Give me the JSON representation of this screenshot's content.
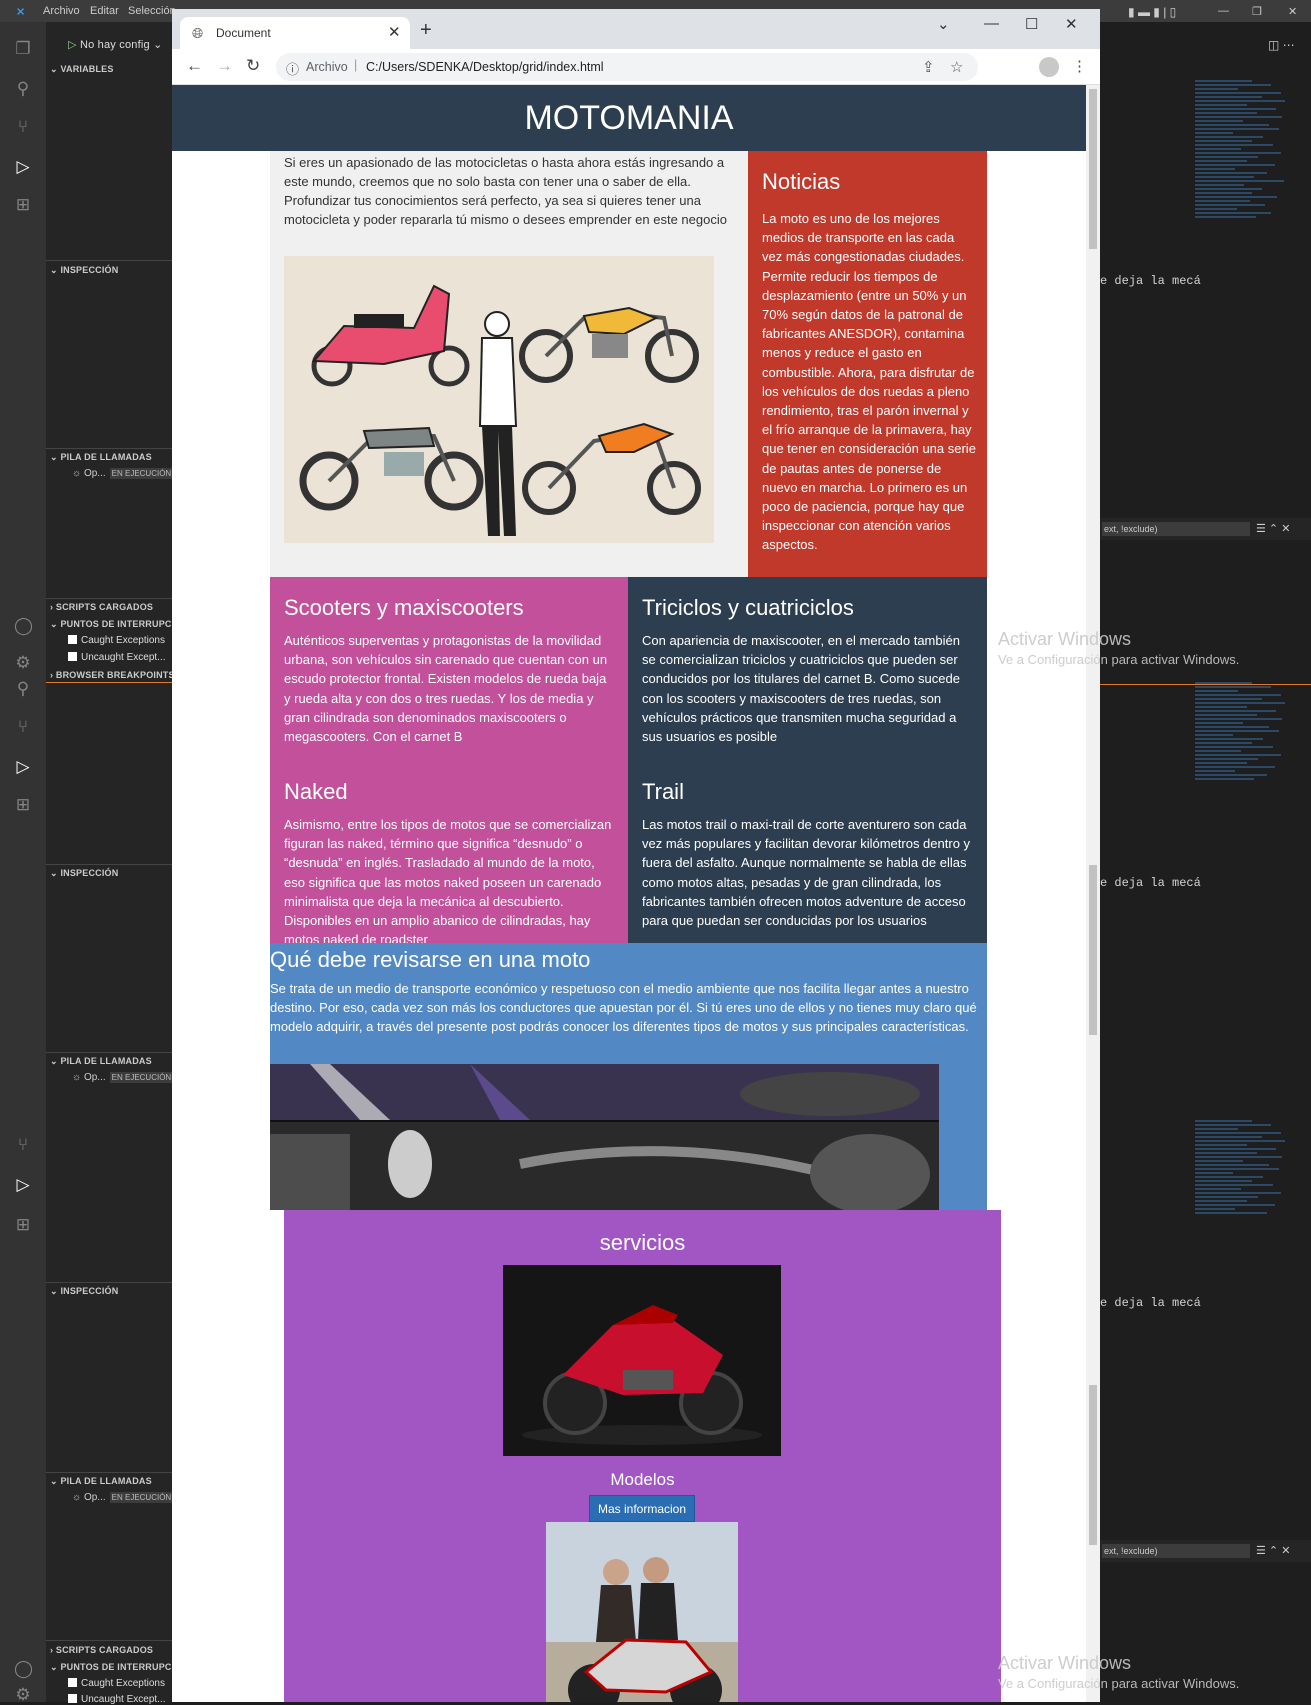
{
  "vscode": {
    "menu": [
      "Archivo",
      "Editar",
      "Selección"
    ],
    "run_config": "No hay config",
    "sections": {
      "variables": "VARIABLES",
      "inspection": "INSPECCIÓN",
      "call_stack": "PILA DE LLAMADAS",
      "scripts": "SCRIPTS CARGADOS",
      "breakpoints": "PUNTOS DE INTERRUPCIÓ",
      "browser_breakpoints": "BROWSER BREAKPOINTS"
    },
    "caught": "Caught Exceptions",
    "uncaught": "Uncaught Except...",
    "thread": "Op...",
    "thread_state": "EN EJECUCIÓN",
    "code_fragment": "e deja la mecá",
    "filter_placeholder": "ext, !exclude)",
    "activate_title": "Activar Windows",
    "activate_sub": "Ve a Configuración para activar Windows."
  },
  "browser": {
    "tab_title": "Document",
    "url_scheme": "Archivo",
    "url": "C:/Users/SDENKA/Desktop/grid/index.html"
  },
  "page": {
    "title": "MOTOMANIA",
    "intro": "Si eres un apasionado de las motocicletas o hasta ahora estás ingresando a este mundo, creemos que no solo basta con tener una o saber de ella. Profundizar tus conocimientos será perfecto, ya sea si quieres tener una motocicleta y poder repararla tú mismo o desees emprender en este negocio",
    "noticias": {
      "title": "Noticias",
      "text": "La moto es uno de los mejores medios de transporte en las cada vez más congestionadas ciudades. Permite reducir los tiempos de desplazamiento (entre un 50% y un 70% según datos de la patronal de fabricantes ANESDOR), contamina menos y reduce el gasto en combustible. Ahora, para disfrutar de los vehículos de dos ruedas a pleno rendimiento, tras el parón invernal y el frío arranque de la primavera, hay que tener en consideración una serie de pautas antes de ponerse de nuevo en marcha. Lo primero es un poco de paciencia, porque hay que inspeccionar con atención varios aspectos."
    },
    "scooters": {
      "title": "Scooters y maxiscooters",
      "text": "Auténticos superventas y protagonistas de la movilidad urbana, son vehículos sin carenado que cuentan con un escudo protector frontal. Existen modelos de rueda baja y rueda alta y con dos o tres ruedas. Y los de media y gran cilindrada son denominados maxiscooters o megascooters. Con el carnet B"
    },
    "triciclos": {
      "title": "Triciclos y cuatriciclos",
      "text": "Con apariencia de maxiscooter, en el mercado también se comercializan triciclos y cuatriciclos que pueden ser conducidos por los titulares del carnet B. Como sucede con los scooters y maxiscooters de tres ruedas, son vehículos prácticos que transmiten mucha seguridad a sus usuarios es posible"
    },
    "naked": {
      "title": "Naked",
      "text": "Asimismo, entre los tipos de motos que se comercializan figuran las naked, término que significa “desnudo” o “desnuda” en inglés. Trasladado al mundo de la moto, eso significa que las motos naked poseen un carenado minimalista que deja la mecánica al descubierto. Disponibles en un amplio abanico de cilindradas, hay motos naked de roadster"
    },
    "trail": {
      "title": "Trail",
      "text": "Las motos trail o maxi-trail de corte aventurero son cada vez más populares y facilitan devorar kilómetros dentro y fuera del asfalto. Aunque normalmente se habla de ellas como motos altas, pesadas y de gran cilindrada, los fabricantes también ofrecen motos adventure de acceso para que puedan ser conducidas por los usuarios"
    },
    "revisar": {
      "title": "Qué debe revisarse en una moto",
      "text": "Se trata de un medio de transporte económico y respetuoso con el medio ambiente que nos facilita llegar antes a nuestro destino. Por eso, cada vez son más los conductores que apuestan por él. Si tú eres uno de ellos y no tienes muy claro qué modelo adquirir, a través del presente post podrás conocer los diferentes tipos de motos y sus principales características."
    },
    "servicios": {
      "title": "servicios",
      "model_label": "Modelos",
      "button": "Mas informacion"
    }
  }
}
